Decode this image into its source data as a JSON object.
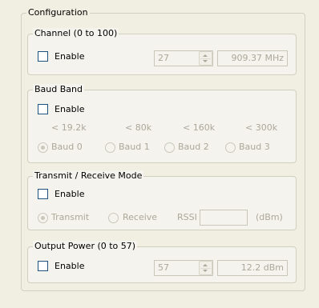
{
  "configuration": {
    "title": "Configuration",
    "channel": {
      "title": "Channel (0 to 100)",
      "enable_label": "Enable",
      "enabled": false,
      "value": "27",
      "readout": "909.37 MHz"
    },
    "baud_band": {
      "title": "Baud Band",
      "enable_label": "Enable",
      "enabled": false,
      "rates": [
        "< 19.2k",
        "< 80k",
        "< 160k",
        "< 300k"
      ],
      "options": [
        "Baud 0",
        "Baud 1",
        "Baud 2",
        "Baud 3"
      ],
      "selected_index": 0
    },
    "trx_mode": {
      "title": "Transmit / Receive Mode",
      "enable_label": "Enable",
      "enabled": false,
      "options": [
        "Transmit",
        "Receive"
      ],
      "selected_index": 0,
      "rssi_label": "RSSI",
      "rssi_value": "",
      "rssi_unit": "(dBm)"
    },
    "output_power": {
      "title": "Output Power (0 to 57)",
      "enable_label": "Enable",
      "enabled": false,
      "value": "57",
      "readout": "12.2 dBm"
    }
  },
  "colors": {
    "window_bg": "#f1efe2",
    "group_border": "#d0d0bf",
    "disabled_text": "#aca899",
    "checkbox_border": "#1c5180"
  }
}
